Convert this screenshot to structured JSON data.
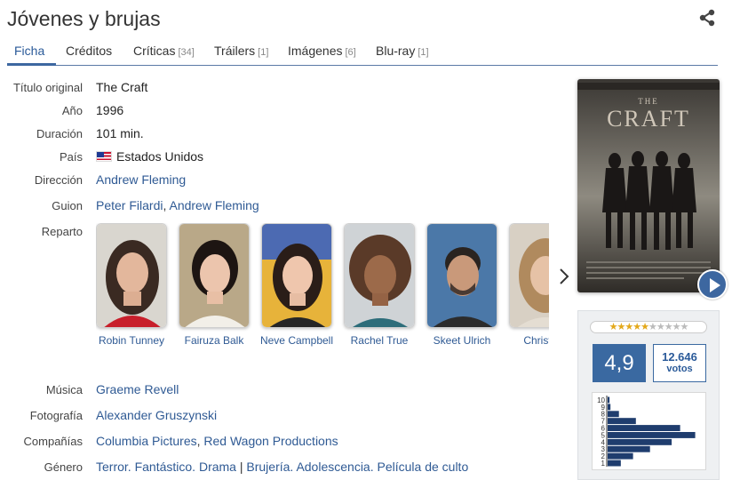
{
  "title": "Jóvenes y brujas",
  "tabs": [
    {
      "label": "Ficha",
      "count": ""
    },
    {
      "label": "Créditos",
      "count": ""
    },
    {
      "label": "Críticas",
      "count": "[34]"
    },
    {
      "label": "Tráilers",
      "count": "[1]"
    },
    {
      "label": "Imágenes",
      "count": "[6]"
    },
    {
      "label": "Blu-ray",
      "count": "[1]"
    }
  ],
  "ficha": {
    "titulo_original": {
      "label": "Título original",
      "value": "The Craft"
    },
    "anio": {
      "label": "Año",
      "value": "1996"
    },
    "duracion": {
      "label": "Duración",
      "value": "101 min."
    },
    "pais": {
      "label": "País",
      "value": "Estados Unidos"
    },
    "direccion": {
      "label": "Dirección",
      "value": "Andrew Fleming"
    },
    "guion": {
      "label": "Guion",
      "names": [
        "Peter Filardi",
        "Andrew Fleming"
      ]
    },
    "reparto_label": "Reparto",
    "musica": {
      "label": "Música",
      "value": "Graeme Revell"
    },
    "fotografia": {
      "label": "Fotografía",
      "value": "Alexander Gruszynski"
    },
    "companias": {
      "label": "Compañías",
      "names": [
        "Columbia Pictures",
        "Red Wagon Productions"
      ]
    },
    "genero": {
      "label": "Género",
      "primary": [
        "Terror",
        "Fantástico",
        "Drama"
      ],
      "secondary": [
        "Brujería",
        "Adolescencia",
        "Película de culto"
      ]
    }
  },
  "cast": [
    {
      "name": "Robin Tunney"
    },
    {
      "name": "Fairuza Balk"
    },
    {
      "name": "Neve Campbell"
    },
    {
      "name": "Rachel True"
    },
    {
      "name": "Skeet Ulrich"
    },
    {
      "name": "Christine"
    }
  ],
  "poster": {
    "the": "THE",
    "title": "CRAFT"
  },
  "rating": {
    "score": "4,9",
    "votes_count": "12.646",
    "votes_label": "votos",
    "stars_filled": 5,
    "stars_total": 10,
    "histogram": [
      {
        "score": "10",
        "share": 0.02
      },
      {
        "score": "9",
        "share": 0.03
      },
      {
        "score": "8",
        "share": 0.12
      },
      {
        "score": "7",
        "share": 0.3
      },
      {
        "score": "6",
        "share": 0.77
      },
      {
        "score": "5",
        "share": 0.93
      },
      {
        "score": "4",
        "share": 0.68
      },
      {
        "score": "3",
        "share": 0.45
      },
      {
        "score": "2",
        "share": 0.27
      },
      {
        "score": "1",
        "share": 0.14
      }
    ]
  }
}
